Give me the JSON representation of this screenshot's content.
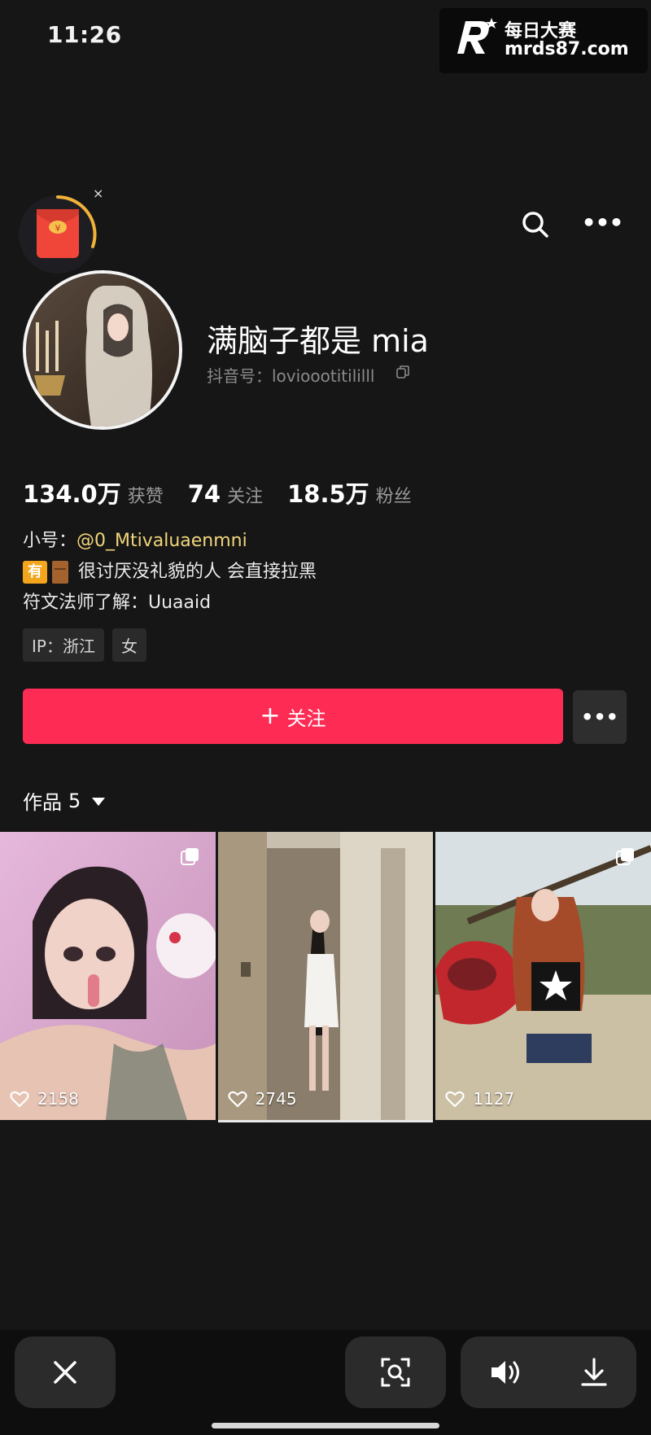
{
  "status": {
    "time": "11:26"
  },
  "watermark": {
    "brand": "每日大赛",
    "url": "mrds87.com"
  },
  "header": {
    "promo_close": "×",
    "more_label": "•••"
  },
  "profile": {
    "nickname": "满脑子都是 mia",
    "douyin_id_label": "抖音号：",
    "douyin_id_value": "lovioootitililll"
  },
  "stats": [
    {
      "value": "134.0万",
      "label": "获赞"
    },
    {
      "value": "74",
      "label": "关注"
    },
    {
      "value": "18.5万",
      "label": "粉丝"
    }
  ],
  "bio": {
    "alt_label": "小号：",
    "alt_handle": "@0_Mtivaluaenmni",
    "badge_text": "有",
    "line2": "很讨厌没礼貌的人 会直接拉黑",
    "line3": "符文法师了解：Uuaaid"
  },
  "tags": [
    "IP：浙江",
    "女"
  ],
  "actions": {
    "follow_label": "关注",
    "follow_plus": "+",
    "more_label": "•••"
  },
  "works": {
    "label": "作品",
    "count": "5",
    "items": [
      {
        "likes": "2158"
      },
      {
        "likes": "2745"
      },
      {
        "likes": "1127"
      }
    ]
  },
  "toolbar": {
    "close": "close-icon",
    "scan": "scan-icon",
    "volume": "volume-icon",
    "download": "download-icon"
  }
}
